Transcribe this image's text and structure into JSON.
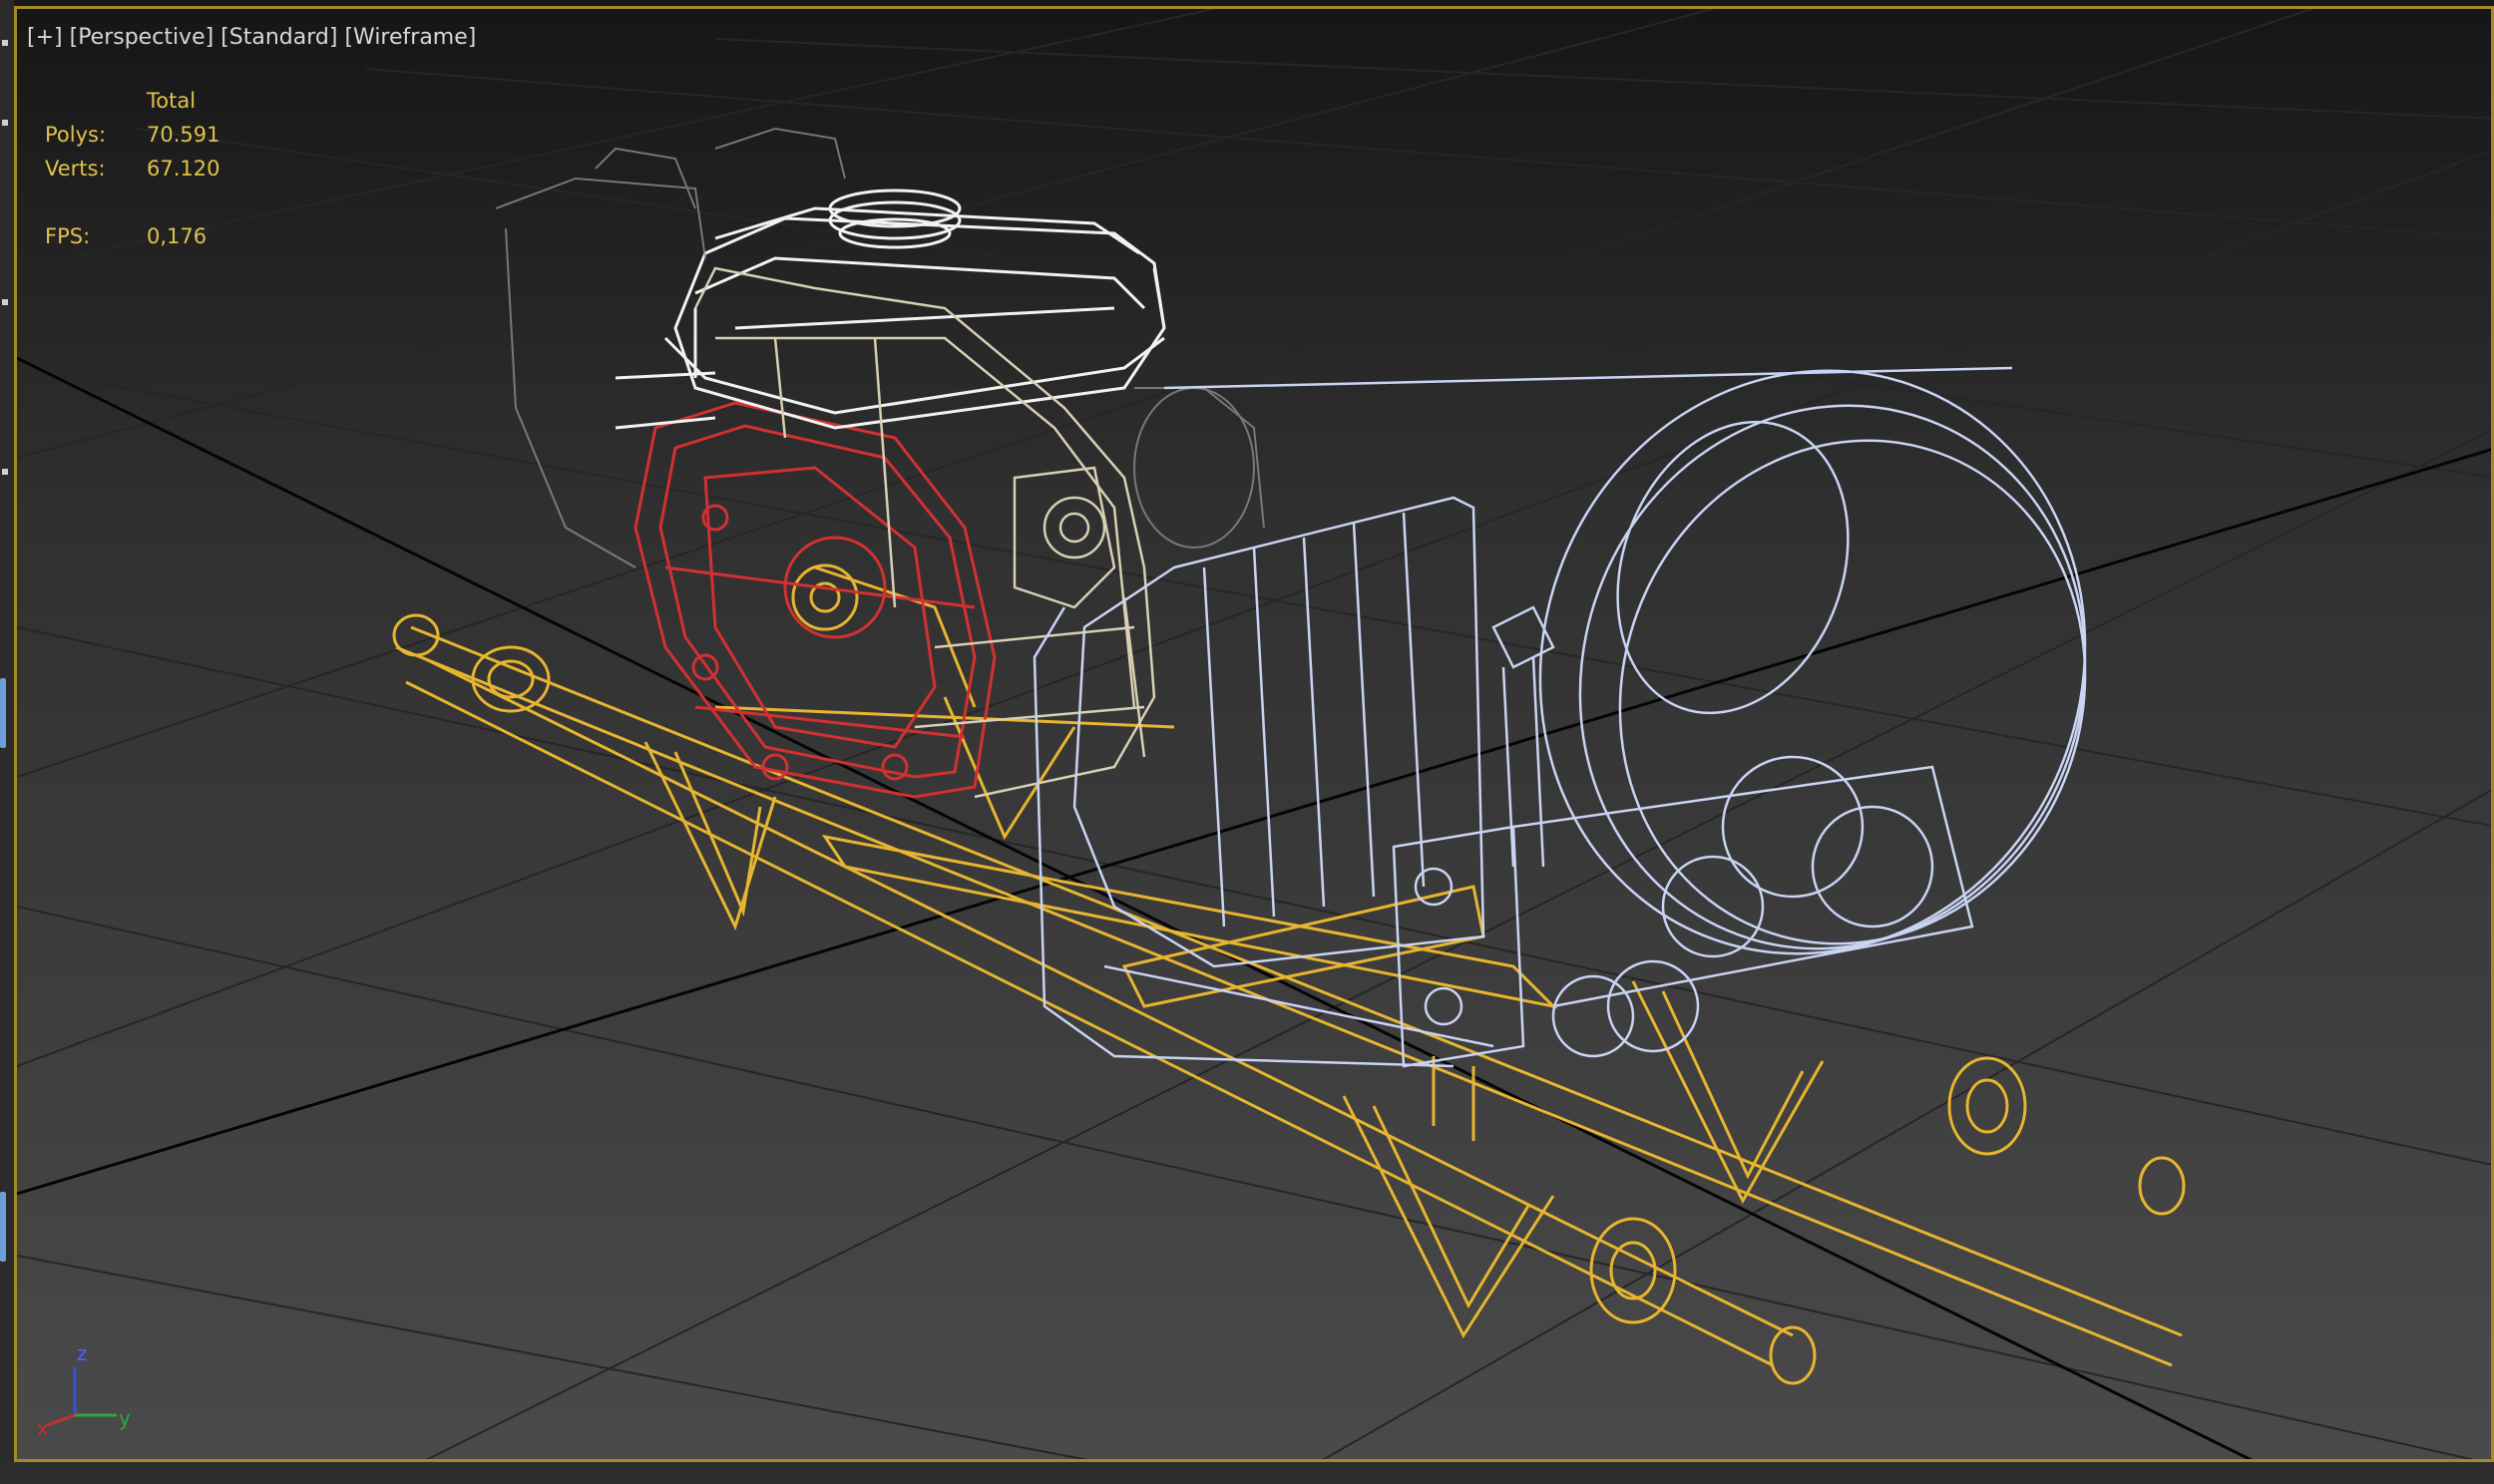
{
  "viewport": {
    "label_plus": "[+]",
    "label_view": "[Perspective]",
    "label_shading": "[Standard]",
    "label_mode": "[Wireframe]"
  },
  "stats": {
    "header": "Total",
    "polys_label": "Polys:",
    "polys_value": "70.591",
    "verts_label": "Verts:",
    "verts_value": "67.120",
    "fps_label": "FPS:",
    "fps_value": "0,176"
  },
  "axis_gizmo": {
    "x": "x",
    "y": "y",
    "z": "z"
  },
  "colors": {
    "viewport_border": "#a58a24",
    "stats_text": "#e2c24a",
    "frame_wire": "#e7b52f",
    "red_wire": "#d23131",
    "white_wire": "#f2f2f2",
    "beige_wire": "#d8cfb4",
    "blue_wire": "#c9d4f4",
    "grid": "#262626"
  }
}
